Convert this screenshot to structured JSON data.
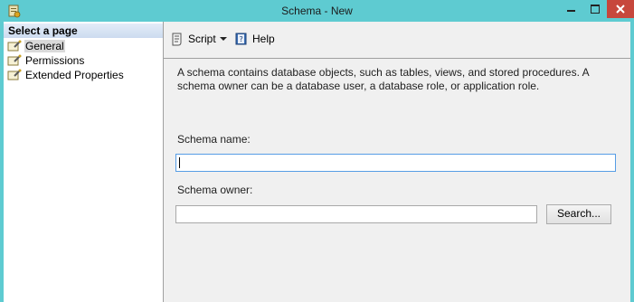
{
  "window": {
    "title": "Schema - New"
  },
  "left_pane": {
    "header": "Select a page",
    "pages": [
      {
        "label": "General",
        "selected": true
      },
      {
        "label": "Permissions",
        "selected": false
      },
      {
        "label": "Extended Properties",
        "selected": false
      }
    ]
  },
  "toolbar": {
    "script_label": "Script",
    "help_label": "Help"
  },
  "form": {
    "description": "A schema contains database objects, such as tables, views, and stored procedures. A schema owner can be a database user, a database role, or application role.",
    "schema_name_label": "Schema name:",
    "schema_name_value": "",
    "schema_owner_label": "Schema owner:",
    "schema_owner_value": "",
    "search_button": "Search..."
  },
  "colors": {
    "titlebar": "#5ecbd1",
    "close_button": "#c7473c",
    "panel_bg": "#f0f0f0",
    "focus_border": "#569de5"
  }
}
